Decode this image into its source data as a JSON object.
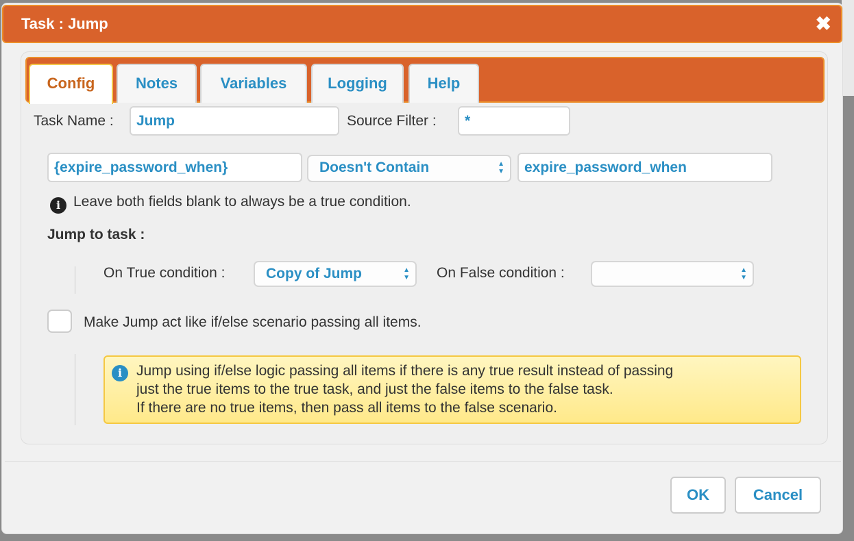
{
  "dialog": {
    "title": "Task : Jump",
    "close_icon": "close-icon"
  },
  "tabs": [
    {
      "label": "Config",
      "active": true
    },
    {
      "label": "Notes"
    },
    {
      "label": "Variables"
    },
    {
      "label": "Logging"
    },
    {
      "label": "Help"
    }
  ],
  "config": {
    "task_name_label": "Task Name :",
    "task_name_value": "Jump",
    "source_filter_label": "Source Filter :",
    "source_filter_value": "*",
    "condition_left": "{expire_password_when}",
    "condition_operator": "Doesn't Contain",
    "condition_right": "expire_password_when",
    "hint": "Leave both fields blank to always be a true condition.",
    "jump_to_label": "Jump to task :",
    "on_true_label": "On True condition :",
    "on_true_value": "Copy of Jump",
    "on_false_label": "On False condition :",
    "on_false_value": "",
    "ifelse_label": "Make Jump act like if/else scenario passing all items.",
    "ifelse_checked": false,
    "note_lines": [
      "Jump using if/else logic passing all items if there is any true result instead of passing",
      "just the true items to the true task, and just the false items to the false task.",
      "If there are no true items, then pass all items to the false scenario."
    ]
  },
  "footer": {
    "ok": "OK",
    "cancel": "Cancel"
  },
  "colors": {
    "accent": "#d9622b",
    "link": "#2a8fc4",
    "active_tab": "#c8651d",
    "note_bg": "#ffef9f"
  }
}
